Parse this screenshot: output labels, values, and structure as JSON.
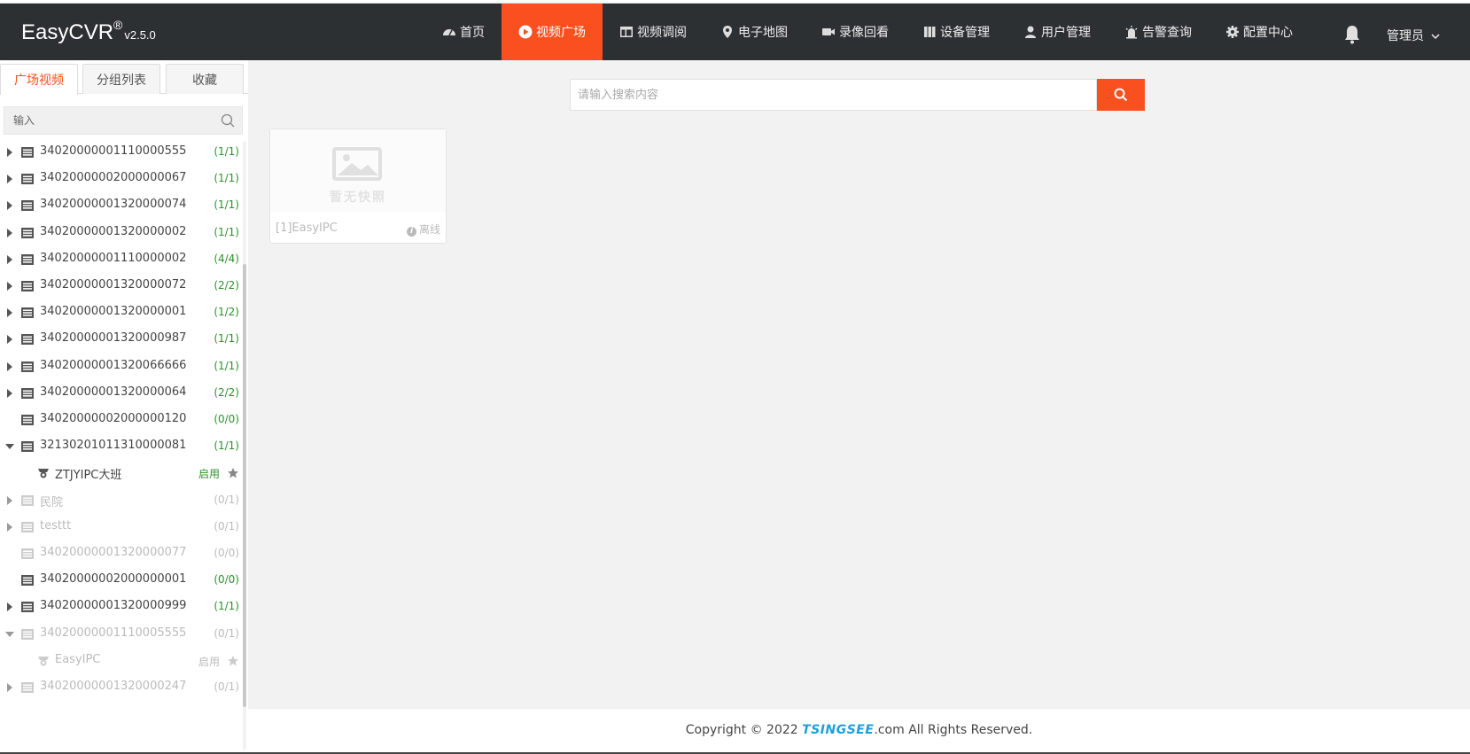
{
  "app": {
    "name": "EasyCVR",
    "reg": "®",
    "version": "v2.5.0"
  },
  "nav": [
    {
      "label": "首页",
      "icon": "dashboard-icon",
      "active": false
    },
    {
      "label": "视频广场",
      "icon": "play-circle-icon",
      "active": true
    },
    {
      "label": "视频调阅",
      "icon": "layout-icon",
      "active": false
    },
    {
      "label": "电子地图",
      "icon": "map-pin-icon",
      "active": false
    },
    {
      "label": "录像回看",
      "icon": "video-camera-icon",
      "active": false
    },
    {
      "label": "设备管理",
      "icon": "device-icon",
      "active": false
    },
    {
      "label": "用户管理",
      "icon": "user-icon",
      "active": false
    },
    {
      "label": "告警查询",
      "icon": "alarm-icon",
      "active": false
    },
    {
      "label": "配置中心",
      "icon": "gear-icon",
      "active": false
    }
  ],
  "user": {
    "label": "管理员"
  },
  "sidebar": {
    "tabs": [
      "广场视频",
      "分组列表",
      "收藏"
    ],
    "filter_placeholder": "输入",
    "tree": [
      {
        "label": "34020000001110000555",
        "count": "(1/1)",
        "arrow": "right",
        "dim": false
      },
      {
        "label": "34020000002000000067",
        "count": "(1/1)",
        "arrow": "right",
        "dim": false
      },
      {
        "label": "34020000001320000074",
        "count": "(1/1)",
        "arrow": "right",
        "dim": false
      },
      {
        "label": "34020000001320000002",
        "count": "(1/1)",
        "arrow": "right",
        "dim": false
      },
      {
        "label": "34020000001110000002",
        "count": "(4/4)",
        "arrow": "right",
        "dim": false
      },
      {
        "label": "34020000001320000072",
        "count": "(2/2)",
        "arrow": "right",
        "dim": false
      },
      {
        "label": "34020000001320000001",
        "count": "(1/2)",
        "arrow": "right",
        "dim": false
      },
      {
        "label": "34020000001320000987",
        "count": "(1/1)",
        "arrow": "right",
        "dim": false
      },
      {
        "label": "34020000001320066666",
        "count": "(1/1)",
        "arrow": "right",
        "dim": false
      },
      {
        "label": "34020000001320000064",
        "count": "(2/2)",
        "arrow": "right",
        "dim": false
      },
      {
        "label": "34020000002000000120",
        "count": "(0/0)",
        "arrow": "none",
        "dim": false
      },
      {
        "label": "32130201011310000081",
        "count": "(1/1)",
        "arrow": "down",
        "dim": false
      },
      {
        "label": "ZTJYIPC大班",
        "status": "启用",
        "child": true,
        "dim": false
      },
      {
        "label": "民院",
        "count": "(0/1)",
        "arrow": "right",
        "dim": true
      },
      {
        "label": "testtt",
        "count": "(0/1)",
        "arrow": "right",
        "dim": true
      },
      {
        "label": "34020000001320000077",
        "count": "(0/0)",
        "arrow": "none",
        "dim": true
      },
      {
        "label": "34020000002000000001",
        "count": "(0/0)",
        "arrow": "none",
        "dim": false
      },
      {
        "label": "34020000001320000999",
        "count": "(1/1)",
        "arrow": "right",
        "dim": false
      },
      {
        "label": "34020000001110005555",
        "count": "(0/1)",
        "arrow": "down",
        "dim": true
      },
      {
        "label": "EasyIPC",
        "status": "启用",
        "child": true,
        "dim": true
      },
      {
        "label": "34020000001320000247",
        "count": "(0/1)",
        "arrow": "right",
        "dim": true
      }
    ]
  },
  "main": {
    "search_placeholder": "请输入搜索内容",
    "cards": [
      {
        "name": "[1]EasyIPC",
        "snapshot_text": "暂无快照",
        "status": "离线"
      }
    ]
  },
  "footer": {
    "prefix": "Copyright © 2022 ",
    "brand": "TSINGSEE",
    "suffix": ".com All Rights Reserved."
  },
  "colors": {
    "accent": "#fa4f1e",
    "header_bg": "#2d3033",
    "online": "#2f8f2f"
  }
}
